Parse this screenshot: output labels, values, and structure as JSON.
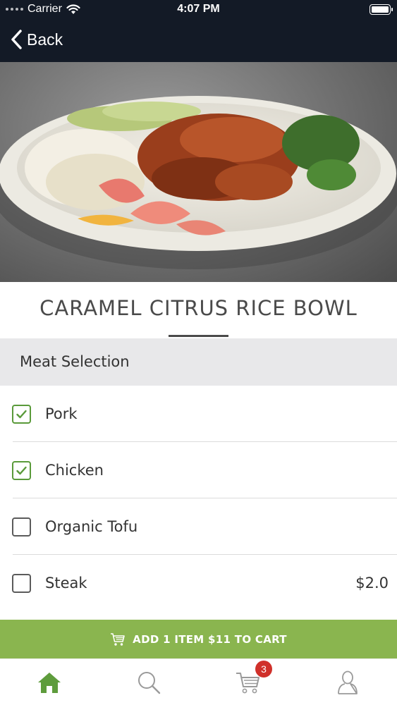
{
  "status_bar": {
    "carrier": "Carrier",
    "time": "4:07 PM"
  },
  "nav": {
    "back_label": "Back"
  },
  "item": {
    "title": "CARAMEL CITRUS RICE BOWL"
  },
  "section": {
    "title": "Meat Selection"
  },
  "options": [
    {
      "label": "Pork",
      "checked": true,
      "price": ""
    },
    {
      "label": "Chicken",
      "checked": true,
      "price": ""
    },
    {
      "label": "Organic Tofu",
      "checked": false,
      "price": ""
    },
    {
      "label": "Steak",
      "checked": false,
      "price": "$2.0"
    }
  ],
  "cart_button": {
    "label": "ADD 1 ITEM $11 TO CART"
  },
  "tabbar": {
    "tabs": [
      {
        "icon": "home-icon",
        "active": true
      },
      {
        "icon": "search-icon",
        "active": false
      },
      {
        "icon": "cart-icon",
        "active": false
      },
      {
        "icon": "profile-icon",
        "active": false
      }
    ],
    "cart_badge": "3"
  },
  "colors": {
    "nav_bg": "#131a26",
    "accent_green": "#8ab54f",
    "check_green": "#5a9a3a",
    "badge_red": "#d0302a",
    "section_bg": "#e8e8ea"
  }
}
